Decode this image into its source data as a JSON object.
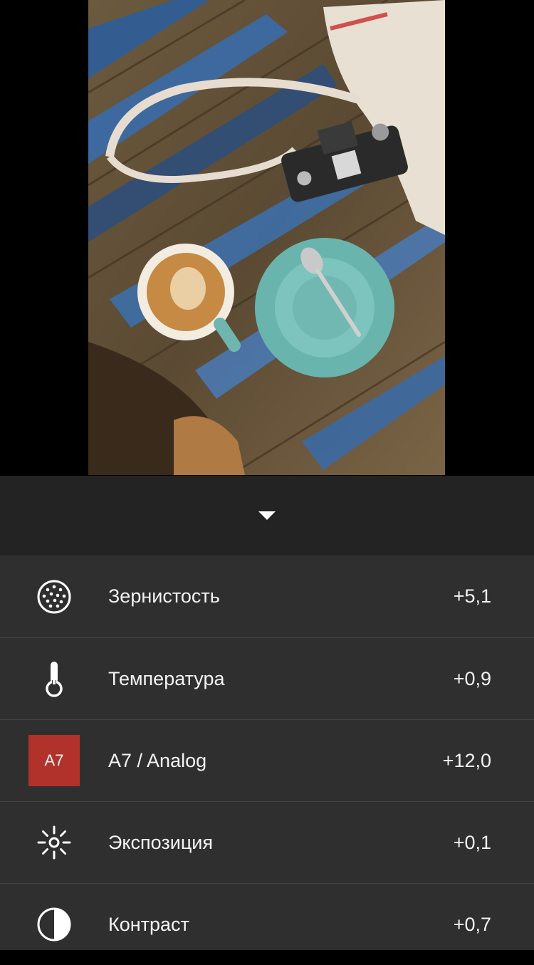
{
  "adjustments": [
    {
      "id": "grain",
      "icon": "grain-icon",
      "label": "Зернистость",
      "value": "+5,1"
    },
    {
      "id": "temperature",
      "icon": "thermometer-icon",
      "label": "Температура",
      "value": "+0,9"
    },
    {
      "id": "preset",
      "icon": "preset-badge",
      "badge": "A7",
      "label": "A7 / Analog",
      "value": "+12,0"
    },
    {
      "id": "exposure",
      "icon": "sun-icon",
      "label": "Экспозиция",
      "value": "+0,1"
    },
    {
      "id": "contrast",
      "icon": "contrast-icon",
      "label": "Контраст",
      "value": "+0,7"
    }
  ],
  "colors": {
    "panel": "#2f2f2f",
    "collapse_bar": "#232323",
    "preset_badge": "#b0322a"
  }
}
